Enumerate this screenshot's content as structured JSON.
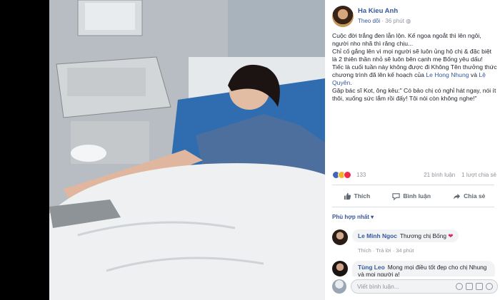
{
  "post": {
    "author": "Ha Kieu Anh",
    "follow_label": "Theo dõi",
    "time": "36 phút",
    "text_lines": [
      "Cuộc đời trắng đen lẫn lộn. Kế ngoa ngoắt thì lên ngôi, người nho nhã thì răng chịu...",
      "Chỉ cố gắng lên vì mọi người sẽ luôn ủng hộ chị & đặc biệt là 2 thiên thần nhỏ sẽ luôn bên cạnh mẹ Bống yêu dấu!",
      "Tiếc là cuối tuần này không được đi Không Tên thưởng thức chương trình đã lên kế hoạch của",
      "Gặp bác sĩ Kot, ông kêu:\" Có bảo chị có nghỉ hát ngay, nói ít thôi, xuống sức lắm rồi đấy! Tôi nói còn không nghe!\""
    ],
    "mention_1": "Le Hong Nhung",
    "mention_and": "và",
    "mention_2": "Lệ Quyên"
  },
  "stats": {
    "reactions": "133",
    "comments": "21 bình luận",
    "shares": "1 lượt chia sẻ"
  },
  "actions": {
    "like": "Thích",
    "comment": "Bình luận",
    "share": "Chia sẻ"
  },
  "sort_label": "Phù hợp nhất ▾",
  "comments": [
    {
      "name": "Le Minh Ngoc",
      "text": "Thương chị Bống",
      "meta": "Thích · Trả lời · 34 phút"
    },
    {
      "name": "Tùng Leo",
      "text": "Mong mọi điều tốt đẹp cho chị",
      "text2": "Nhung và mọi người a!"
    }
  ],
  "write_placeholder": "Viết bình luận...",
  "colors": {
    "link": "#365899",
    "muted": "#90949c",
    "heart": "#e0245e"
  }
}
